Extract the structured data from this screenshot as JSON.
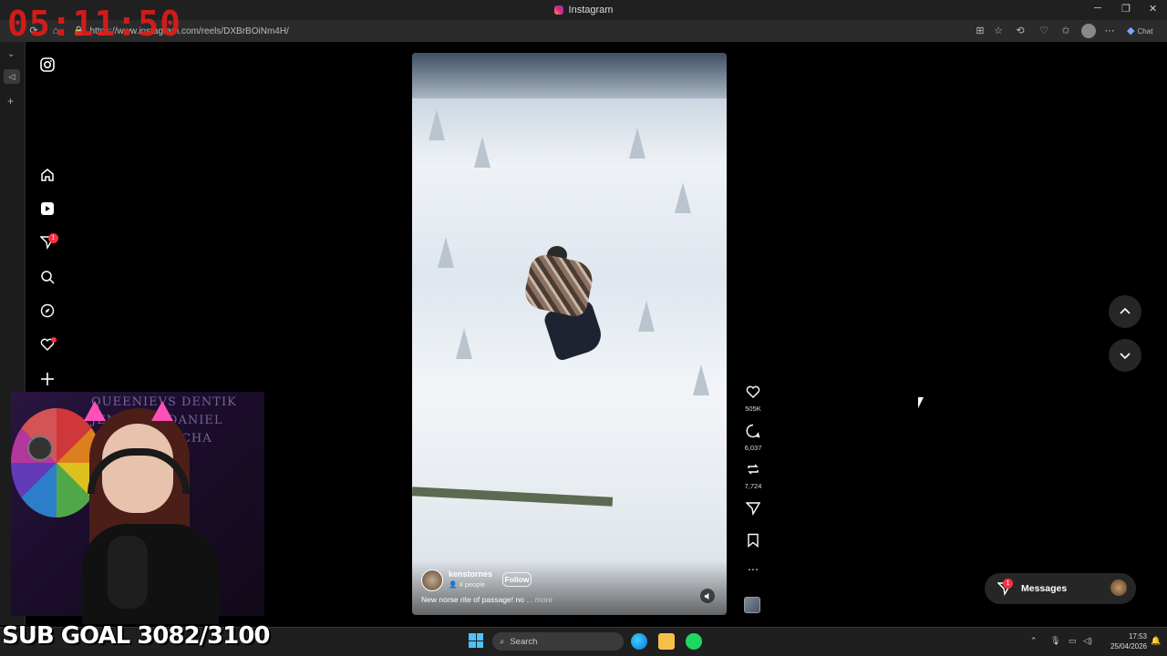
{
  "window": {
    "title": "Instagram",
    "minimize": "─",
    "maximize": "❐",
    "close": "✕"
  },
  "browser": {
    "url": "https://www.instagram.com/reels/DXBrBOiNm4H/",
    "copilot_label": "Chat"
  },
  "instagram": {
    "notification_count": "1",
    "reel": {
      "username": "kenstornes",
      "collab": "4 people",
      "follow_label": "Follow",
      "caption": "New norse rite of passage! no",
      "caption_more": "... more",
      "likes": "505K",
      "comments": "6,037",
      "reposts": "7,724"
    },
    "messages": {
      "label": "Messages",
      "badge": "1"
    }
  },
  "overlay": {
    "timer": "05:11:50",
    "subgoal": "SUB GOAL 3082/3100",
    "wall_text": "QUEENIEVS DENTIK JENNIFER DANIEL NEAL TALK ICHA"
  },
  "taskbar": {
    "search_placeholder": "Search",
    "time": "17:53",
    "date": "25/04/2026"
  },
  "colors": {
    "ig_red": "#ff3040",
    "timer_red": "#e21b1b",
    "background": "#000000"
  }
}
